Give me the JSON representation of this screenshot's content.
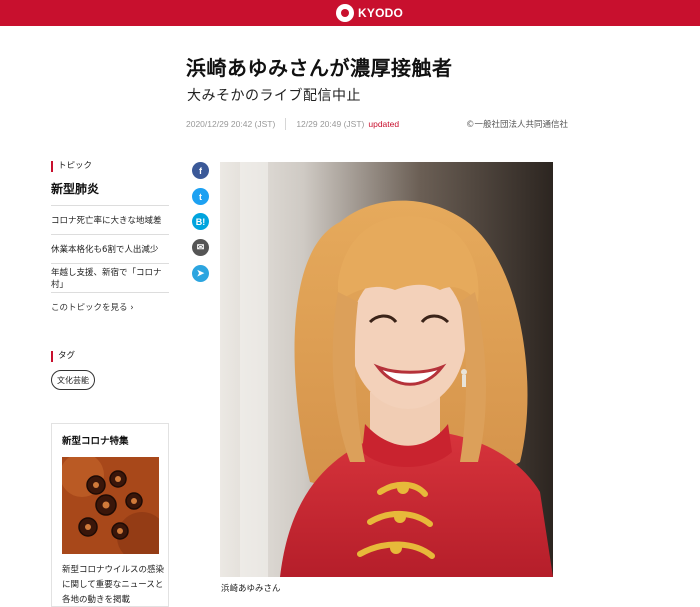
{
  "header": {
    "brand": "KYODO",
    "brand_color": "#c8102e",
    "logo_icon": "kyodo-logo-mark"
  },
  "article": {
    "headline": "浜崎あゆみさんが濃厚接触者",
    "subhead": "大みそかのライブ配信中止",
    "published": "2020/12/29 20:42 (JST)",
    "updated_time": "12/29 20:49 (JST)",
    "updated_label": "updated",
    "copyright": "©一般社団法人共同通信社",
    "photo_caption": "浜崎あゆみさん"
  },
  "sidebar": {
    "topic_heading": "トピック",
    "topic_title": "新型肺炎",
    "topic_items": [
      "コロナ死亡率に大きな地域差",
      "休業本格化も6割で人出減少",
      "年越し支援、新宿で「コロナ村」"
    ],
    "topic_more": "このトピックを見る ›",
    "tag_heading": "タグ",
    "tags": [
      "文化芸能"
    ],
    "feature": {
      "title": "新型コロナ特集",
      "desc_lines": [
        "新型コロナウイルスの感染",
        "に関して重要なニュースと",
        "各地の動きを掲載"
      ]
    }
  },
  "share": [
    {
      "icon": "facebook-icon",
      "glyph": "f",
      "color": "#3b5998"
    },
    {
      "icon": "twitter-icon",
      "glyph": "t",
      "color": "#1da1f2"
    },
    {
      "icon": "hatena-bookmark-icon",
      "glyph": "B!",
      "color": "#00a4de"
    },
    {
      "icon": "mail-icon",
      "glyph": "✉",
      "color": "#555555"
    },
    {
      "icon": "telegram-icon",
      "glyph": "➤",
      "color": "#2ca5e0"
    }
  ]
}
